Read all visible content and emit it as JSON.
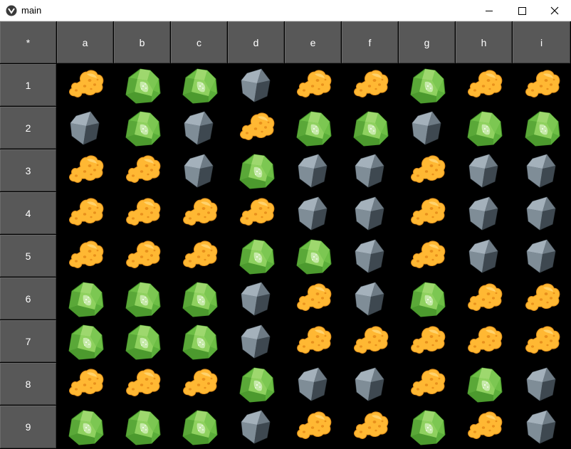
{
  "window": {
    "title": "main",
    "icon": "app-icon",
    "controls": [
      "minimize-icon",
      "maximize-icon",
      "close-icon"
    ]
  },
  "grid": {
    "corner": "*",
    "columns": [
      "a",
      "b",
      "c",
      "d",
      "e",
      "f",
      "g",
      "h",
      "i"
    ],
    "rows": [
      "1",
      "2",
      "3",
      "4",
      "5",
      "6",
      "7",
      "8",
      "9"
    ],
    "cells": [
      [
        "gold",
        "gem",
        "gem",
        "stone",
        "gold",
        "gold",
        "gem",
        "gold",
        "gold"
      ],
      [
        "stone",
        "gem",
        "stone",
        "gold",
        "gem",
        "gem",
        "stone",
        "gem",
        "gem"
      ],
      [
        "gold",
        "gold",
        "stone",
        "gem",
        "stone",
        "stone",
        "gold",
        "stone",
        "stone"
      ],
      [
        "gold",
        "gold",
        "gold",
        "gold",
        "stone",
        "stone",
        "gold",
        "stone",
        "stone"
      ],
      [
        "gold",
        "gold",
        "gold",
        "gem",
        "gem",
        "stone",
        "gold",
        "stone",
        "stone"
      ],
      [
        "gem",
        "gem",
        "gem",
        "stone",
        "gold",
        "stone",
        "gem",
        "gold",
        "gold"
      ],
      [
        "gem",
        "gem",
        "gem",
        "stone",
        "gold",
        "gold",
        "gold",
        "gold",
        "gold"
      ],
      [
        "gold",
        "gold",
        "gold",
        "gem",
        "stone",
        "stone",
        "gold",
        "gem",
        "stone"
      ],
      [
        "gem",
        "gem",
        "gem",
        "stone",
        "gold",
        "gold",
        "gem",
        "gold",
        "stone"
      ]
    ]
  },
  "colors": {
    "header_bg": "#585858",
    "grid_bg": "#000000",
    "gold": "#FFB833",
    "gem": "#6DBE45",
    "stone": "#4F5A63"
  }
}
